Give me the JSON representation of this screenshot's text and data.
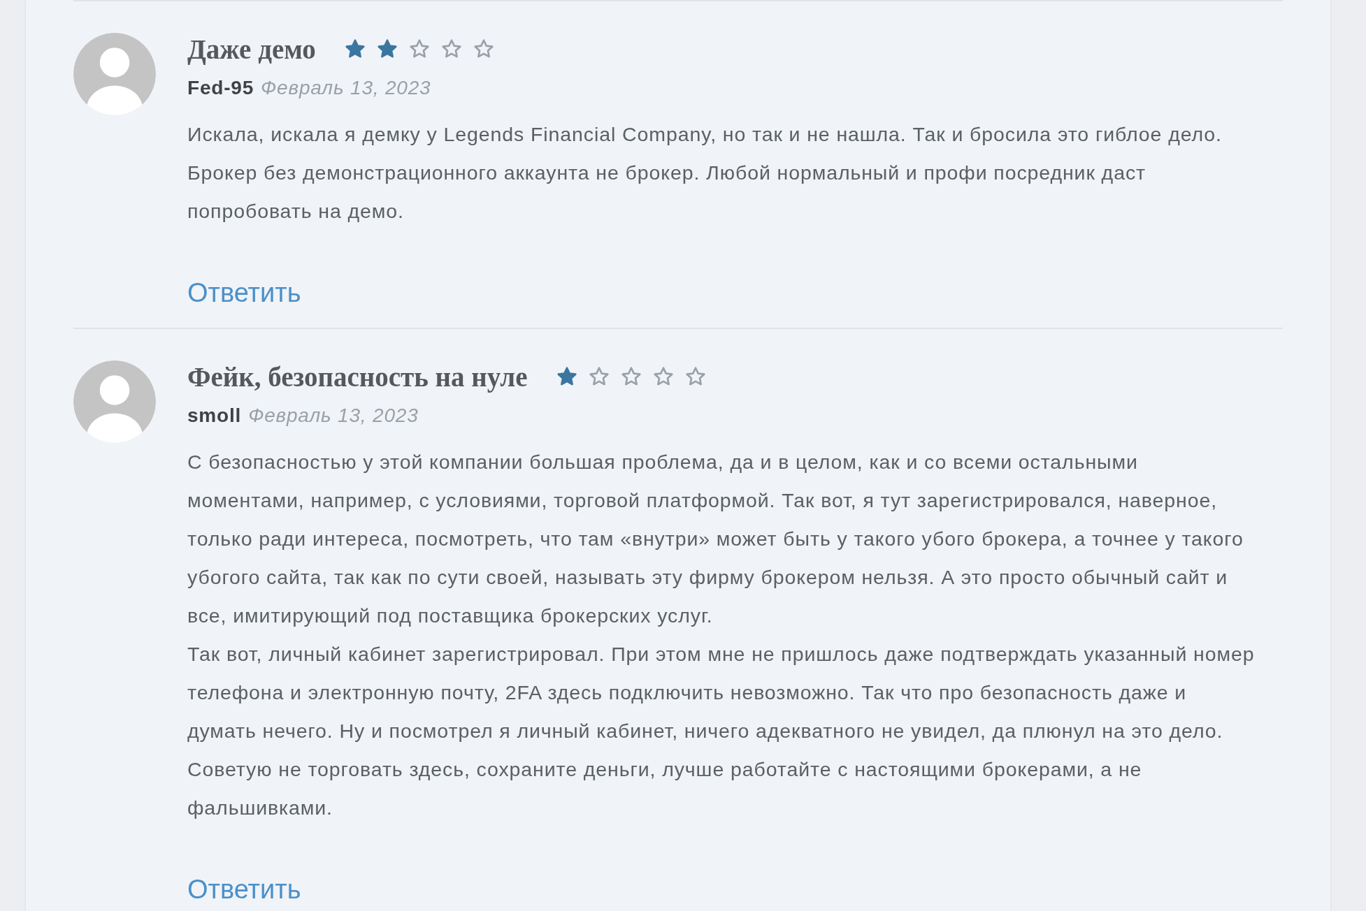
{
  "reviews": [
    {
      "title": "Даже демо",
      "stars": 2,
      "author": "Fed-95",
      "date": "Февраль 13, 2023",
      "paragraphs": [
        "Искала, искала я демку у Legends Financial Company, но так и не нашла. Так и бросила это гиблое дело. Брокер без демонстрационного аккаунта не брокер. Любой нормальный и профи посредник даст попробовать на демо."
      ],
      "reply": "Ответить"
    },
    {
      "title": "Фейк, безопасность на нуле",
      "stars": 1,
      "author": "smoll",
      "date": "Февраль 13, 2023",
      "paragraphs": [
        "С безопасностью у этой компании большая проблема, да и в целом, как и со всеми остальными моментами, например, с условиями, торговой платформой. Так вот, я тут зарегистрировался, наверное, только ради интереса, посмотреть, что там «внутри» может быть у такого убого брокера, а точнее у такого убогого сайта, так как по сути своей, называть эту фирму брокером нельзя. А это просто обычный сайт и все, имитирующий под поставщика брокерских услуг.",
        "Так вот, личный кабинет зарегистрировал. При этом мне не пришлось даже подтверждать указанный номер телефона и электронную почту, 2FA здесь подключить невозможно. Так что про безопасность даже и думать нечего. Ну и посмотрел я личный кабинет, ничего адекватного не увидел, да плюнул на это дело. Советую не торговать здесь, сохраните деньги, лучше работайте с настоящими брокерами, а не фальшивками."
      ],
      "reply": "Ответить"
    }
  ]
}
